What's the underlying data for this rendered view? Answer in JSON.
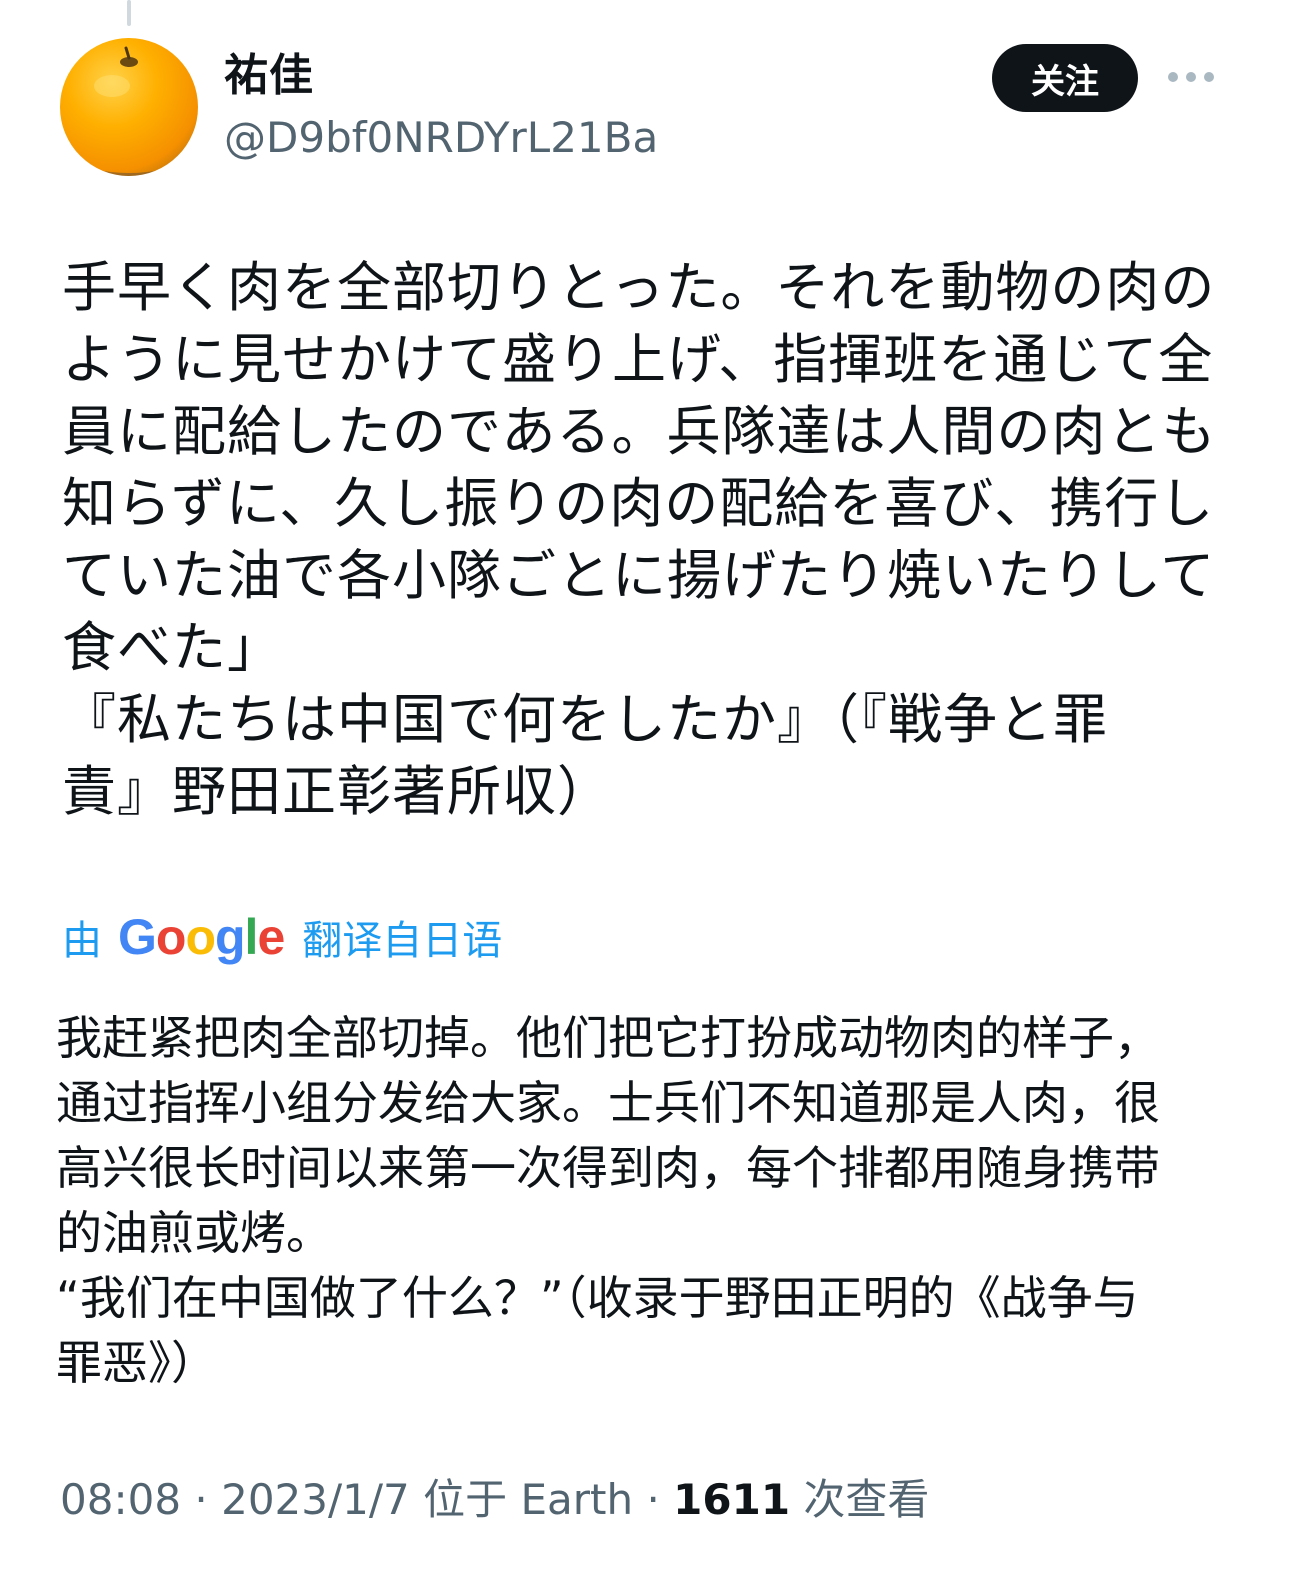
{
  "author": {
    "display_name": "祐佳",
    "handle": "@D9bf0NRDYrL21Ba",
    "avatar_icon": "orange-fruit-icon"
  },
  "actions": {
    "follow_label": "关注",
    "more_icon": "more-horizontal-icon"
  },
  "tweet": {
    "original_lines": [
      "手早く肉を全部切りとった。それを動物の肉の",
      "ように見せかけて盛り上げ、指揮班を通じて全",
      "員に配給したのである。兵隊達は人間の肉とも",
      "知らずに、久し振りの肉の配給を喜び、携行し",
      "ていた油で各小隊ごとに揚げたり焼いたりして",
      "食べた」",
      "『私たちは中国で何をしたか』（『戦争と罪",
      "責』野田正彰著所収）"
    ],
    "translation": {
      "prefix": "由",
      "provider": "Google",
      "suffix": "翻译自日语"
    },
    "translated_lines": [
      "我赶紧把肉全部切掉。他们把它打扮成动物肉的样子，",
      "通过指挥小组分发给大家。士兵们不知道那是人肉，很",
      "高兴很长时间以来第一次得到肉，每个排都用随身携带",
      "的油煎或烤。",
      "“我们在中国做了什么？”（收录于野田正明的《战争与",
      "罪恶》）"
    ]
  },
  "meta": {
    "time": "08:08",
    "separator": " · ",
    "date": "2023/1/7",
    "location": "位于 Earth",
    "views_count": "1611",
    "views_label": "次查看"
  },
  "colors": {
    "link_blue": "#1d9bf0",
    "muted_gray": "#536471",
    "text_black": "#0f1419",
    "google_blue": "#4285f4",
    "google_red": "#ea4335",
    "google_yellow": "#fbbc05",
    "google_green": "#34a853"
  }
}
